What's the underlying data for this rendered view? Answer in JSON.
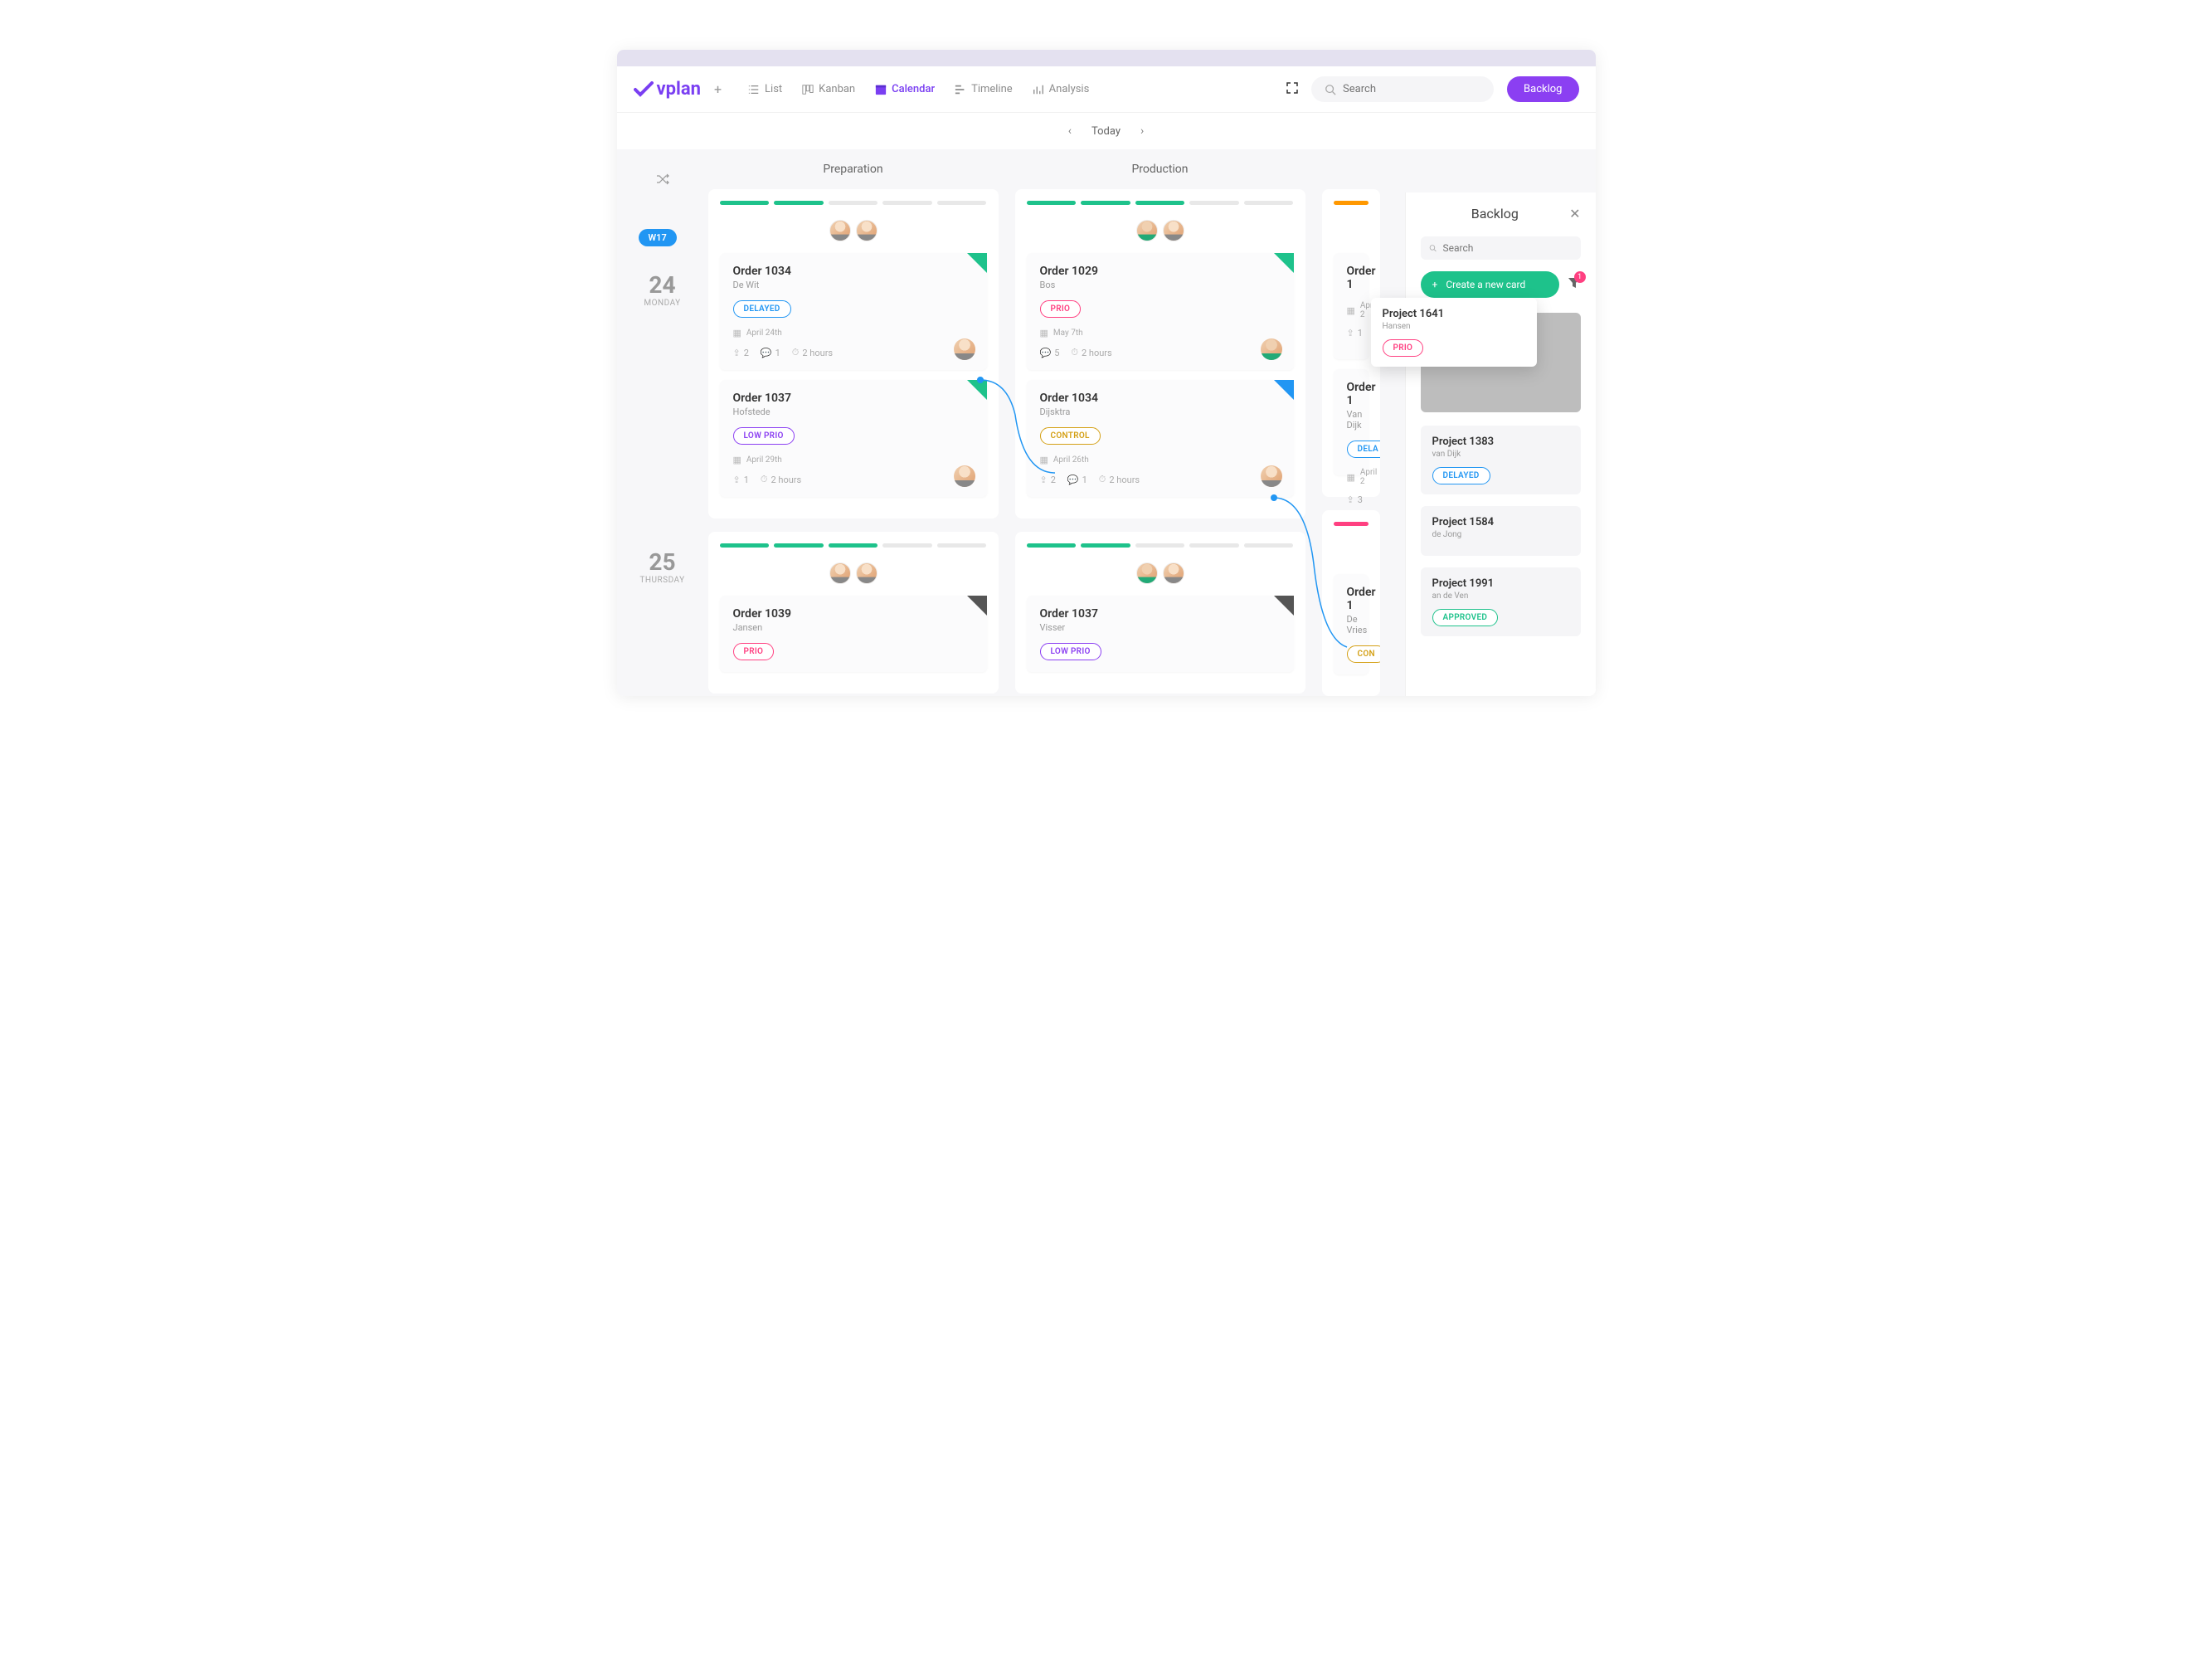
{
  "app": {
    "name": "vplan"
  },
  "nav": {
    "list": "List",
    "kanban": "Kanban",
    "calendar": "Calendar",
    "timeline": "Timeline",
    "analysis": "Analysis"
  },
  "search": {
    "placeholder": "Search"
  },
  "backlog_button": "Backlog",
  "subheader": {
    "today": "Today"
  },
  "columns": {
    "preparation": "Preparation",
    "production": "Production"
  },
  "week_badge": "W17",
  "days": [
    {
      "num": "24",
      "name": "MONDAY"
    },
    {
      "num": "25",
      "name": "THURSDAY"
    }
  ],
  "cards": {
    "prep_day1": [
      {
        "title": "Order 1034",
        "sub": "De Wit",
        "tag": "DELAYED",
        "tag_class": "delayed",
        "date": "April 24th",
        "corner": "green",
        "stats": {
          "up": "2",
          "chat": "1",
          "time": "2 hours"
        }
      },
      {
        "title": "Order 1037",
        "sub": "Hofstede",
        "tag": "LOW PRIO",
        "tag_class": "lowprio",
        "date": "April 29th",
        "corner": "green",
        "stats": {
          "up": "1",
          "time": "2 hours"
        }
      }
    ],
    "prep_day2": [
      {
        "title": "Order 1039",
        "sub": "Jansen",
        "tag": "PRIO",
        "tag_class": "prio",
        "corner": "grey"
      }
    ],
    "prod_day1": [
      {
        "title": "Order 1029",
        "sub": "Bos",
        "tag": "PRIO",
        "tag_class": "prio",
        "date": "May 7th",
        "corner": "green",
        "stats": {
          "chat": "5",
          "time": "2 hours"
        }
      },
      {
        "title": "Order 1034",
        "sub": "Dijsktra",
        "tag": "CONTROL",
        "tag_class": "control",
        "date": "April 26th",
        "corner": "blue",
        "stats": {
          "up": "2",
          "chat": "1",
          "time": "2 hours"
        }
      }
    ],
    "prod_day2": [
      {
        "title": "Order 1037",
        "sub": "Visser",
        "tag": "LOW PRIO",
        "tag_class": "lowprio",
        "corner": "grey"
      }
    ],
    "col3_day1": [
      {
        "title_partial": "Order 1",
        "sub": "",
        "date_partial": "April 2",
        "stats": {
          "up": "1"
        }
      },
      {
        "title_partial": "Order 1",
        "sub": "Van Dijk",
        "tag_partial": "DELA",
        "tag_class": "delayed",
        "date_partial": "April 2",
        "stats": {
          "up": "3"
        }
      }
    ],
    "col3_day2": [
      {
        "title_partial": "Order 1",
        "sub": "De Vries",
        "tag_partial": "CON",
        "tag_class": "control"
      }
    ]
  },
  "backlog": {
    "title": "Backlog",
    "search_placeholder": "Search",
    "create_label": "Create a new card",
    "filter_count": "1",
    "floating_card": {
      "title": "Project 1641",
      "sub": "Hansen",
      "tag": "PRIO",
      "tag_class": "prio"
    },
    "items": [
      {
        "title": "Project 1383",
        "sub": "van Dijk",
        "tag": "DELAYED",
        "tag_class": "delayed"
      },
      {
        "title": "Project 1584",
        "sub": "de Jong"
      },
      {
        "title": "Project 1991",
        "sub": "an de Ven",
        "tag": "APPROVED",
        "tag_class": "approved"
      }
    ]
  }
}
